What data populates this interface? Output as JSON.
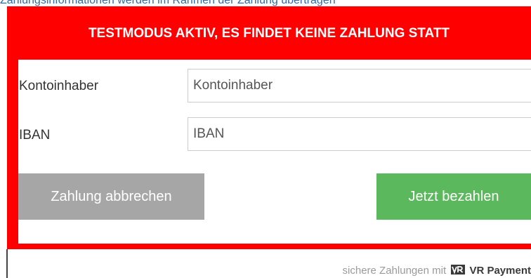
{
  "header": {
    "top_text": "Zahlungsinformationen werden im Rahmen der Zahlung übertragen"
  },
  "form": {
    "banner": "TESTMODUS AKTIV, ES FINDET KEINE ZAHLUNG STATT",
    "account_holder": {
      "label": "Kontoinhaber",
      "placeholder": "Kontoinhaber",
      "value": ""
    },
    "iban": {
      "label": "IBAN",
      "placeholder": "IBAN",
      "value": ""
    },
    "cancel_label": "Zahlung abbrechen",
    "pay_label": "Jetzt bezahlen"
  },
  "footer": {
    "text": "sichere Zahlungen mit",
    "brand": "VR Payment",
    "logo_icon": "vr-bank-logo-icon"
  },
  "colors": {
    "frame": "#ff0000",
    "pay_button": "#5cb85c",
    "cancel_button": "#a6a6a6"
  }
}
